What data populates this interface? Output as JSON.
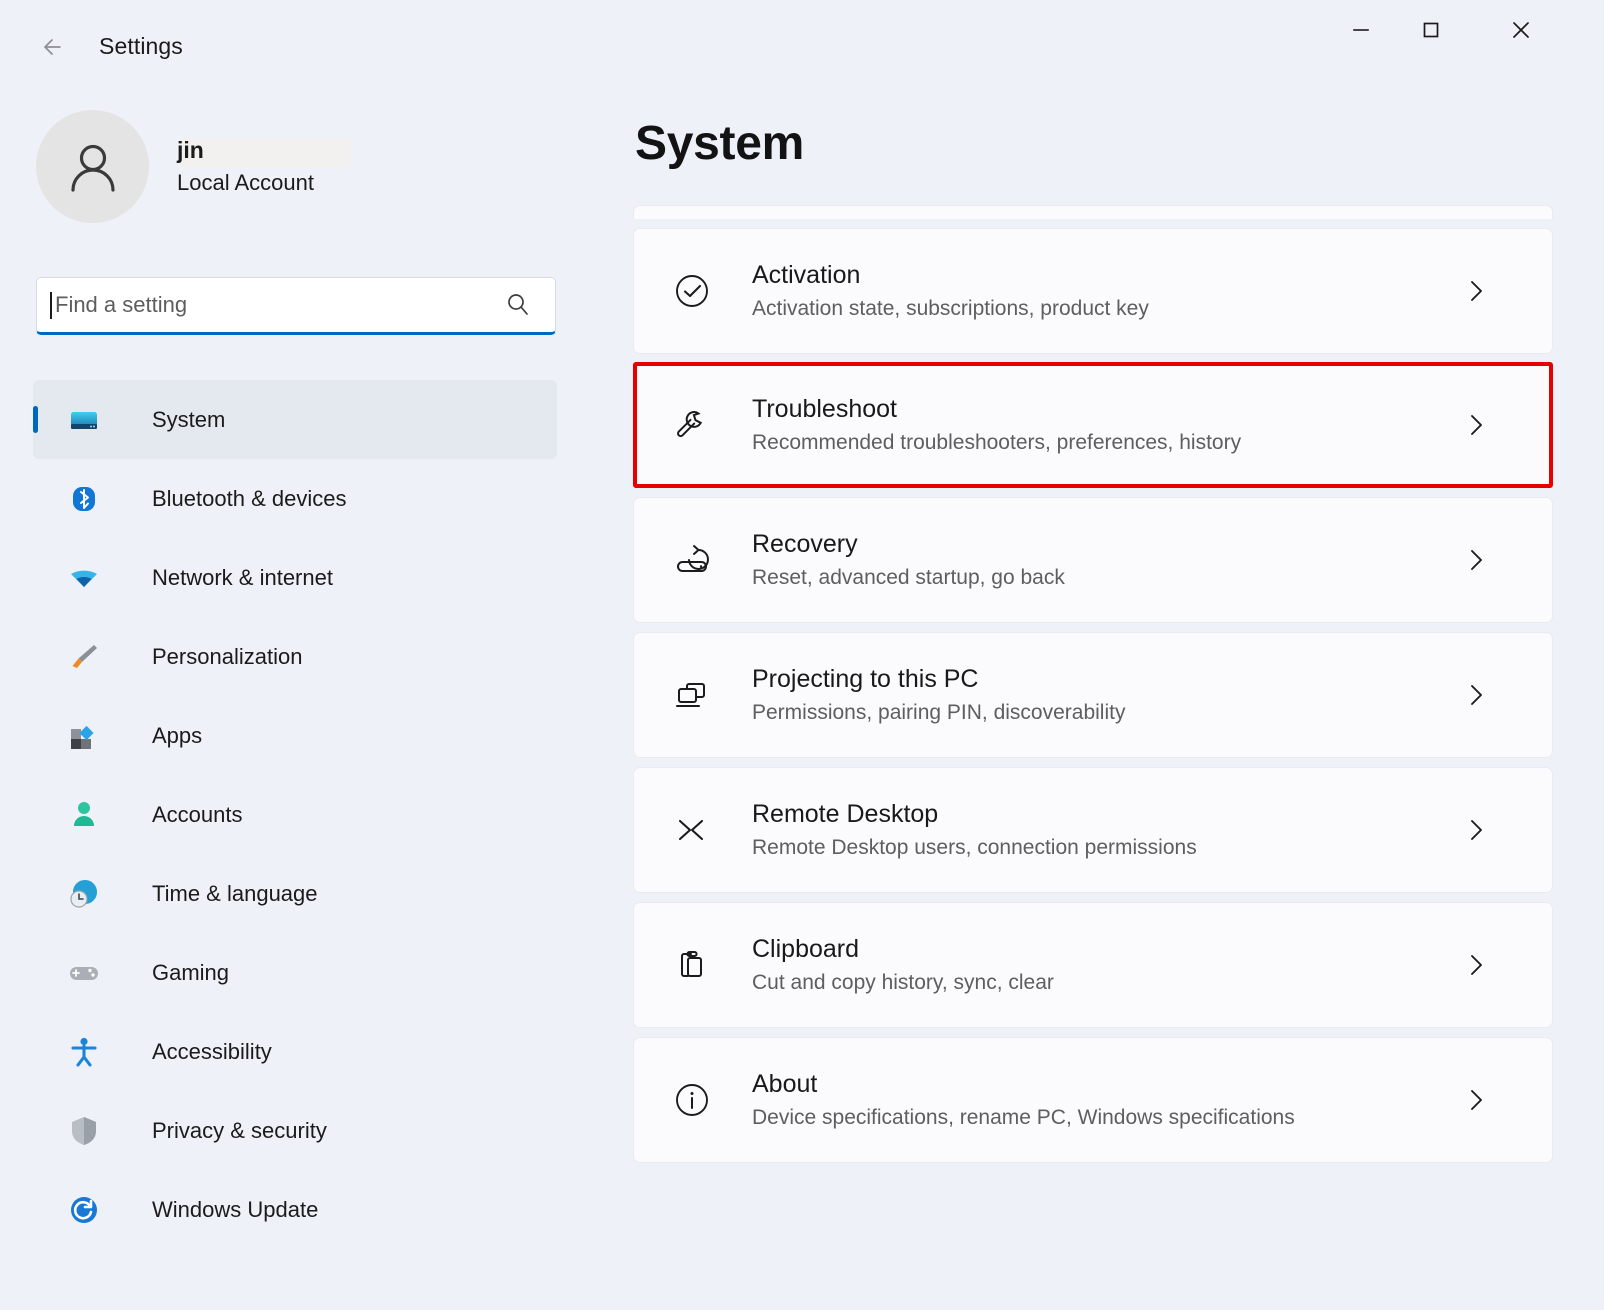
{
  "window": {
    "title": "Settings",
    "back_icon": "back-arrow-icon",
    "controls": [
      {
        "name": "minimize-button",
        "glyph": "minimize-icon"
      },
      {
        "name": "maximize-button",
        "glyph": "maximize-icon"
      },
      {
        "name": "close-button",
        "glyph": "close-icon"
      }
    ]
  },
  "account": {
    "name": "jin",
    "type": "Local Account",
    "avatar_icon": "person-avatar-icon"
  },
  "search": {
    "placeholder": "Find a setting",
    "value": "",
    "icon": "search-icon",
    "focused": true
  },
  "sidebar": {
    "items": [
      {
        "label": "System",
        "icon": "display-monitor-icon",
        "selected": true
      },
      {
        "label": "Bluetooth & devices",
        "icon": "bluetooth-icon",
        "selected": false
      },
      {
        "label": "Network & internet",
        "icon": "wifi-icon",
        "selected": false
      },
      {
        "label": "Personalization",
        "icon": "paintbrush-icon",
        "selected": false
      },
      {
        "label": "Apps",
        "icon": "apps-blocks-icon",
        "selected": false
      },
      {
        "label": "Accounts",
        "icon": "person-icon",
        "selected": false
      },
      {
        "label": "Time & language",
        "icon": "globe-clock-icon",
        "selected": false
      },
      {
        "label": "Gaming",
        "icon": "gamepad-icon",
        "selected": false
      },
      {
        "label": "Accessibility",
        "icon": "accessibility-person-icon",
        "selected": false
      },
      {
        "label": "Privacy & security",
        "icon": "shield-icon",
        "selected": false
      },
      {
        "label": "Windows Update",
        "icon": "update-refresh-icon",
        "selected": false
      }
    ]
  },
  "main": {
    "page_title": "System",
    "cards": [
      {
        "title": "Activation",
        "subtitle": "Activation state, subscriptions, product key",
        "icon": "check-circle-icon",
        "chevron": "chevron-right-icon",
        "highlighted": false
      },
      {
        "title": "Troubleshoot",
        "subtitle": "Recommended troubleshooters, preferences, history",
        "icon": "wrench-icon",
        "chevron": "chevron-right-icon",
        "highlighted": true
      },
      {
        "title": "Recovery",
        "subtitle": "Reset, advanced startup, go back",
        "icon": "recovery-device-icon",
        "chevron": "chevron-right-icon",
        "highlighted": false
      },
      {
        "title": "Projecting to this PC",
        "subtitle": "Permissions, pairing PIN, discoverability",
        "icon": "projecting-screens-icon",
        "chevron": "chevron-right-icon",
        "highlighted": false
      },
      {
        "title": "Remote Desktop",
        "subtitle": "Remote Desktop users, connection permissions",
        "icon": "remote-desktop-arrows-icon",
        "chevron": "chevron-right-icon",
        "highlighted": false
      },
      {
        "title": "Clipboard",
        "subtitle": "Cut and copy history, sync, clear",
        "icon": "clipboard-icon",
        "chevron": "chevron-right-icon",
        "highlighted": false
      },
      {
        "title": "About",
        "subtitle": "Device specifications, rename PC, Windows specifications",
        "icon": "info-circle-icon",
        "chevron": "chevron-right-icon",
        "highlighted": false
      }
    ]
  },
  "colors": {
    "window_background": "#eef1f8",
    "card_background": "#fbfbfd",
    "accent_blue": "#0067c0",
    "highlight_red": "#e60000",
    "text_primary": "#1b1b1b",
    "text_secondary": "#5e5e5e"
  }
}
